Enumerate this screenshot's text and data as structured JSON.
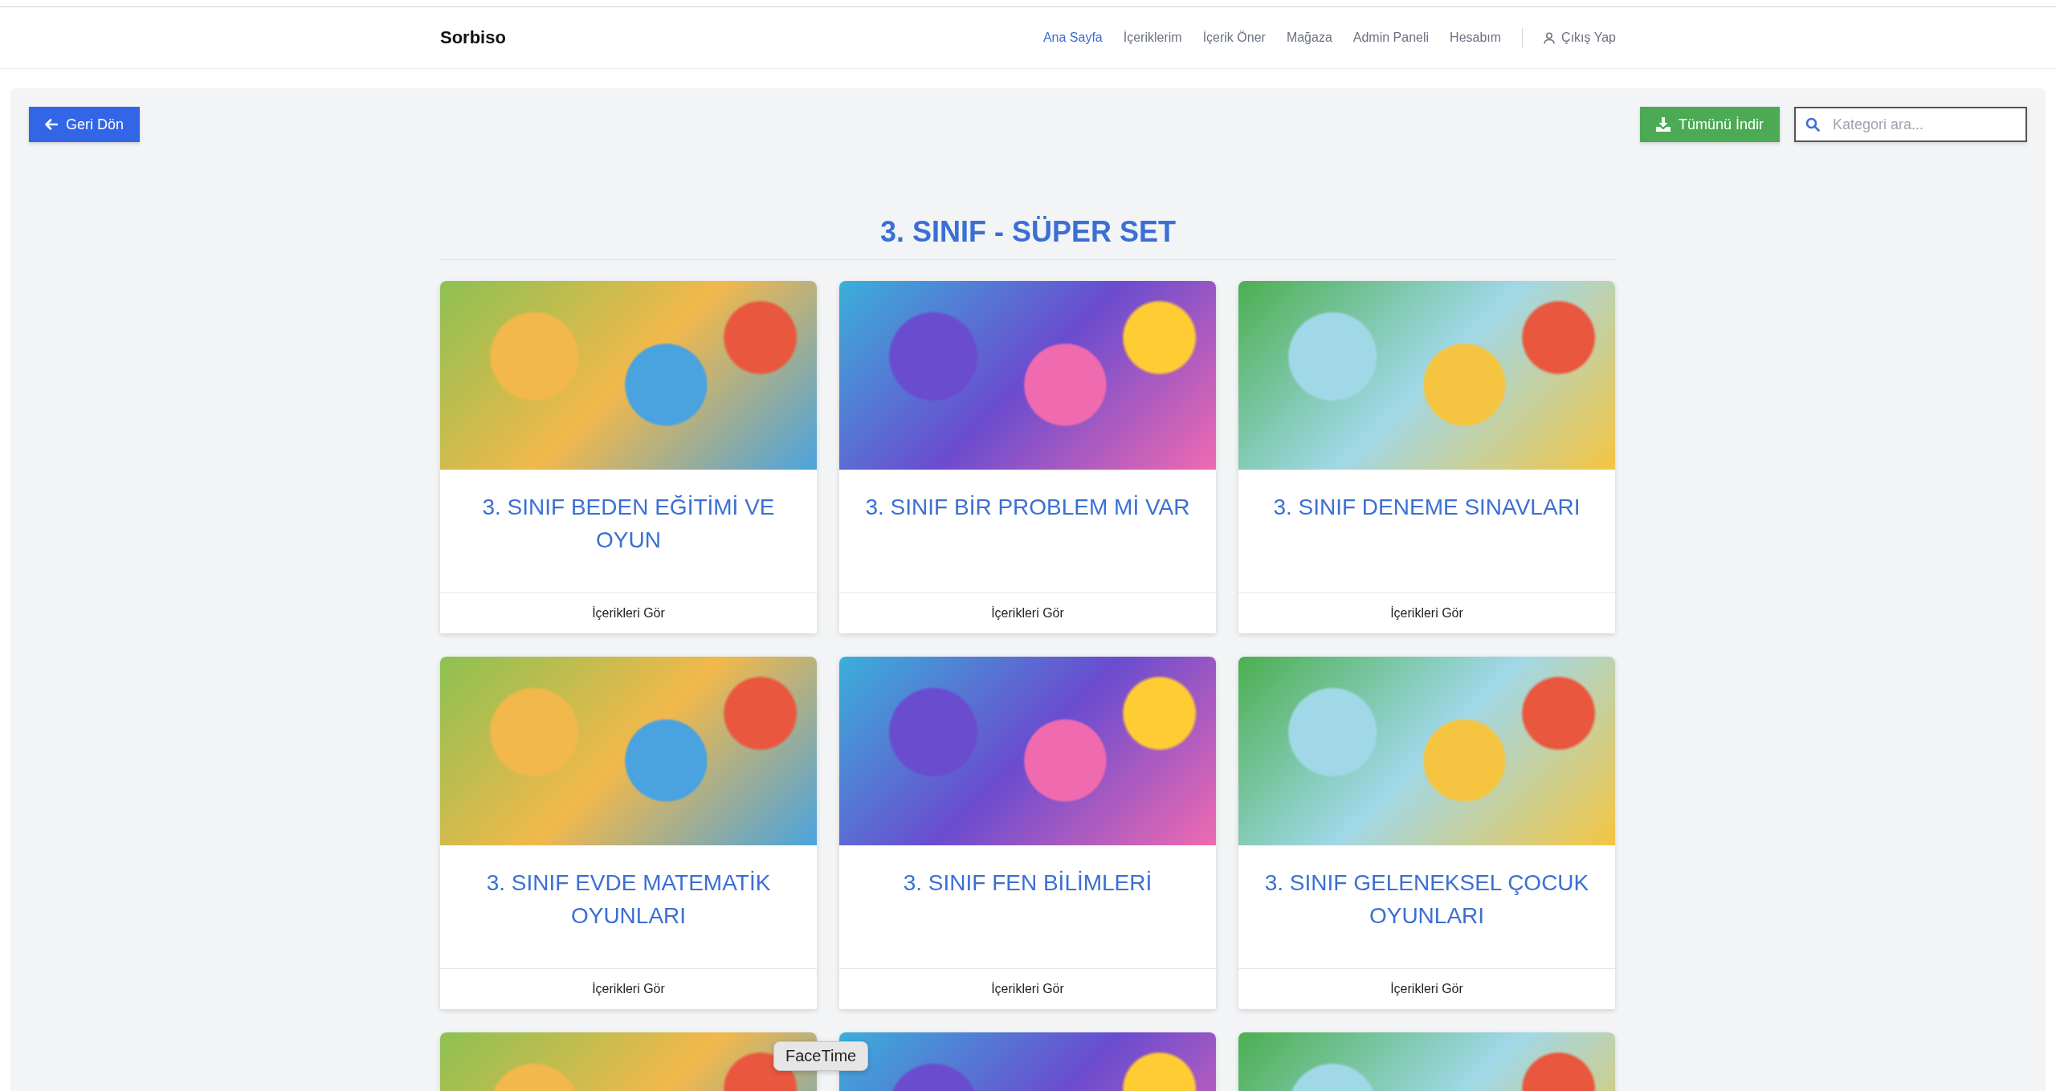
{
  "header": {
    "brand": "Sorbiso",
    "nav": [
      {
        "label": "Ana Sayfa",
        "selected": true
      },
      {
        "label": "İçeriklerim",
        "selected": false
      },
      {
        "label": "İçerik Öner",
        "selected": false
      },
      {
        "label": "Mağaza",
        "selected": false
      },
      {
        "label": "Admin Paneli",
        "selected": false
      },
      {
        "label": "Hesabım",
        "selected": false
      }
    ],
    "logout": "Çıkış Yap"
  },
  "toolbar": {
    "back_button": "Geri Dön",
    "download_button": "Tümünü İndir",
    "search": {
      "placeholder": "Kategori ara..."
    }
  },
  "title": "3. SINIF - SÜPER SET",
  "cards": [
    {
      "title": "3. SINIF BEDEN EĞİTİMİ VE OYUN",
      "action": "İçerikleri Gör"
    },
    {
      "title": "3. SINIF BİR PROBLEM Mİ VAR",
      "action": "İçerikleri Gör"
    },
    {
      "title": "3. SINIF DENEME SINAVLARI",
      "action": "İçerikleri Gör"
    },
    {
      "title": "3. SINIF EVDE MATEMATİK OYUNLARI",
      "action": "İçerikleri Gör"
    },
    {
      "title": "3. SINIF FEN BİLİMLERİ",
      "action": "İçerikleri Gör"
    },
    {
      "title": "3. SINIF GELENEKSEL ÇOCUK OYUNLARI",
      "action": "İçerikleri Gör"
    },
    {
      "kind": "image_only"
    },
    {
      "kind": "image_only"
    },
    {
      "kind": "image_only"
    }
  ],
  "tooltip": "FaceTime"
}
